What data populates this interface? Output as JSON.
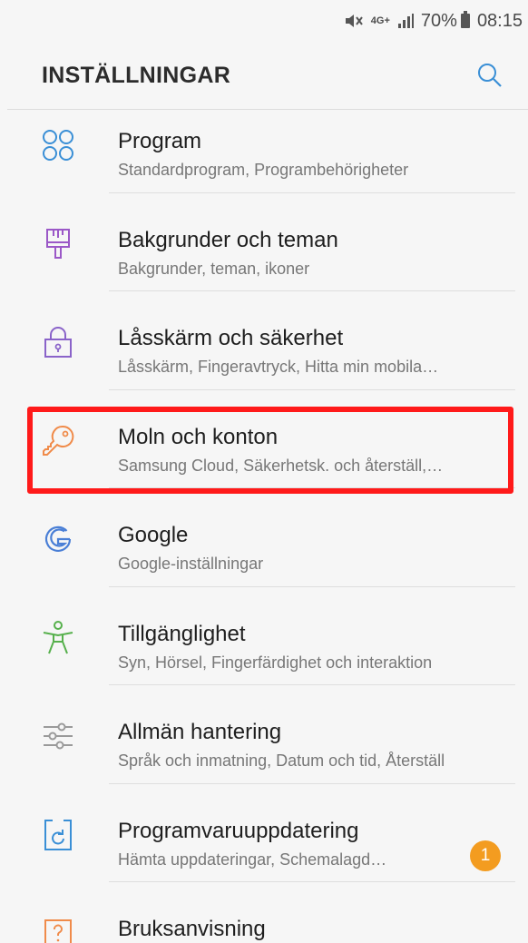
{
  "status_bar": {
    "network": "4G+",
    "battery": "70%",
    "time": "08:15"
  },
  "header": {
    "title": "INSTÄLLNINGAR",
    "search_icon": "search-icon"
  },
  "items": [
    {
      "label": "Program",
      "sub": "Standardprogram, Programbehörigheter",
      "icon": "apps-icon",
      "color": "#3a8fd6"
    },
    {
      "label": "Bakgrunder och teman",
      "sub": "Bakgrunder, teman, ikoner",
      "icon": "paintbrush-icon",
      "color": "#9b58c7"
    },
    {
      "label": "Låsskärm och säkerhet",
      "sub": "Låsskärm, Fingeravtryck, Hitta min mobila…",
      "icon": "lock-icon",
      "color": "#8a63c9"
    },
    {
      "label": "Moln och konton",
      "sub": "Samsung Cloud, Säkerhetsk. och återställ,…",
      "icon": "key-icon",
      "color": "#f08b4a"
    },
    {
      "label": "Google",
      "sub": "Google-inställningar",
      "icon": "google-icon",
      "color": "#4a7fd6"
    },
    {
      "label": "Tillgänglighet",
      "sub": "Syn, Hörsel, Fingerfärdighet och interaktion",
      "icon": "accessibility-icon",
      "color": "#56b04c"
    },
    {
      "label": "Allmän hantering",
      "sub": "Språk och inmatning, Datum och tid, Återställ",
      "icon": "sliders-icon",
      "color": "#9a9a9a"
    },
    {
      "label": "Programvaruuppdatering",
      "sub": "Hämta uppdateringar, Schemalagd…",
      "icon": "update-icon",
      "color": "#3a8fd6",
      "badge": "1"
    },
    {
      "label": "Bruksanvisning",
      "sub": "",
      "icon": "manual-icon",
      "color": "#f08b4a"
    }
  ],
  "colors": {
    "highlight": "#ff1a1a",
    "badge": "#f39c20"
  }
}
